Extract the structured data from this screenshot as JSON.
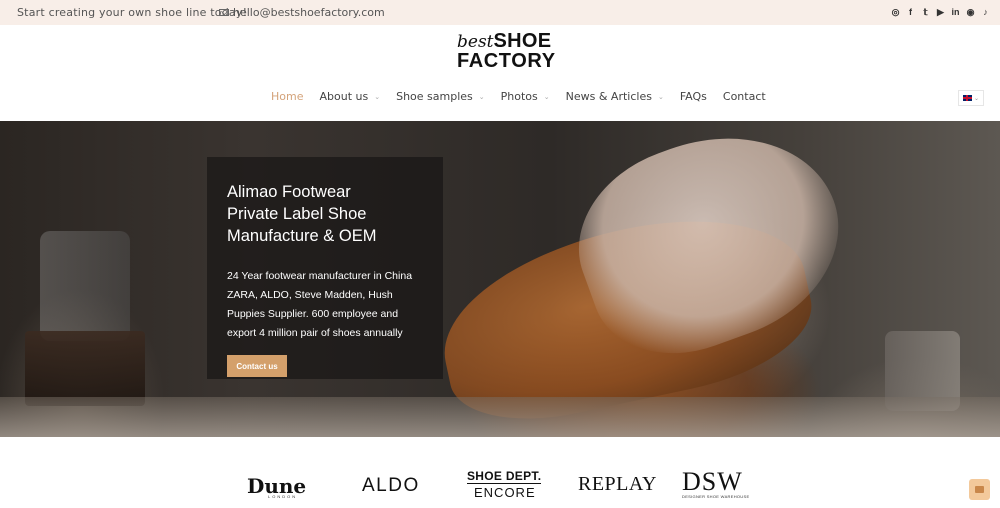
{
  "topbar": {
    "tagline": "Start creating your own shoe line today!",
    "email": "hello@bestshoefactory.com",
    "social": [
      "whatsapp-icon",
      "facebook-icon",
      "twitter-icon",
      "youtube-icon",
      "linkedin-icon",
      "instagram-icon",
      "tiktok-icon"
    ],
    "social_glyphs": [
      "◎",
      "f",
      "𝕥",
      "▶",
      "in",
      "◉",
      "♪"
    ]
  },
  "logo": {
    "best": "best",
    "shoe": "SHOE",
    "factory": "FACTORY"
  },
  "nav": {
    "items": [
      {
        "label": "Home",
        "active": true,
        "dropdown": false
      },
      {
        "label": "About us",
        "active": false,
        "dropdown": true
      },
      {
        "label": "Shoe samples",
        "active": false,
        "dropdown": true
      },
      {
        "label": "Photos",
        "active": false,
        "dropdown": true
      },
      {
        "label": "News & Articles",
        "active": false,
        "dropdown": true
      },
      {
        "label": "FAQs",
        "active": false,
        "dropdown": false
      },
      {
        "label": "Contact",
        "active": false,
        "dropdown": false
      }
    ],
    "chevron": "⌄"
  },
  "hero": {
    "title_lines": [
      "Alimao Footwear",
      "Private Label Shoe",
      "Manufacture & OEM"
    ],
    "description": "24 Year footwear manufacturer in China ZARA, ALDO, Steve Madden, Hush Puppies Supplier. 600 employee and export 4 million pair of shoes annually",
    "button_label": "Contact us"
  },
  "brands": {
    "dune": "Dune",
    "dune_sub": "LONDON",
    "aldo": "ALDO",
    "shoe_dept": "SHOE DEPT.",
    "encore": "ENCORE",
    "replay": "REPLAY",
    "dsw": "DSW",
    "dsw_sub": "DESIGNER SHOE WAREHOUSE"
  },
  "colors": {
    "accent": "#d4a37a",
    "topbar_bg": "#f8eee8",
    "button": "#d4a06b"
  }
}
